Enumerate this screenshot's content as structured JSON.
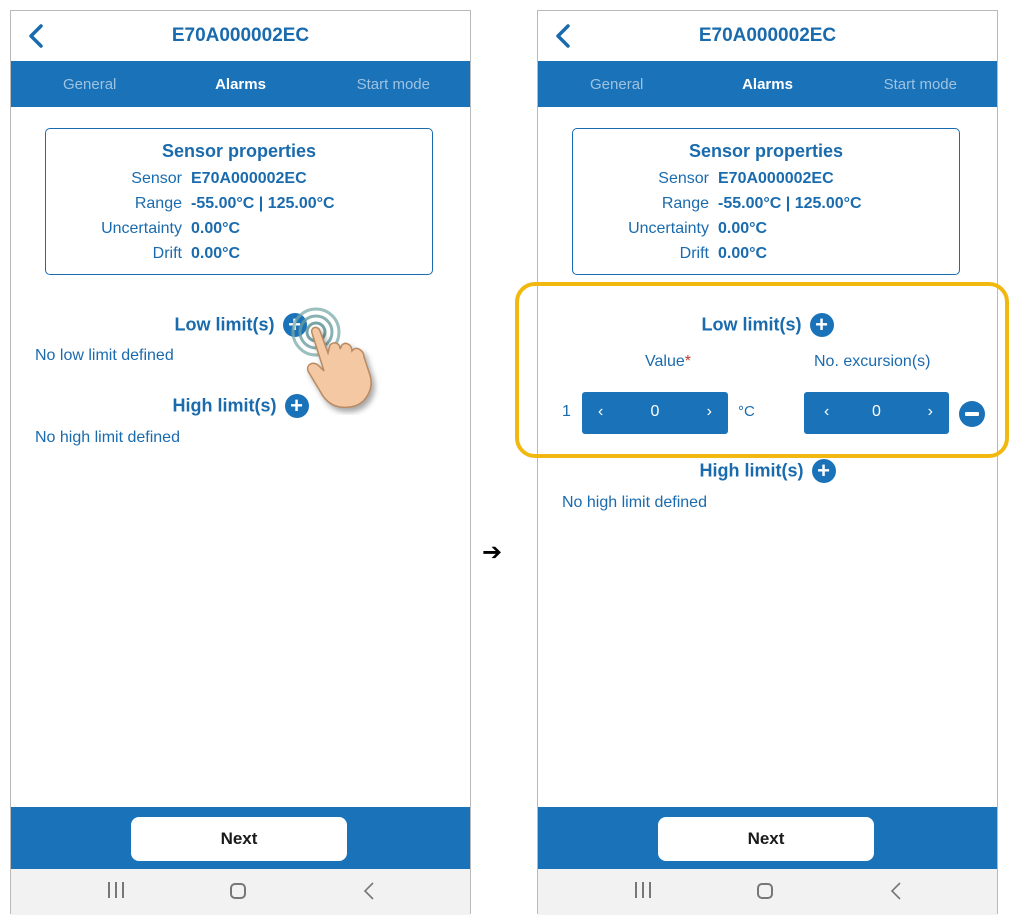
{
  "screens": [
    {
      "title": "E70A000002EC",
      "tabs": [
        "General",
        "Alarms",
        "Start mode"
      ],
      "sensor_properties": {
        "heading": "Sensor properties",
        "rows": [
          {
            "label": "Sensor",
            "value": "E70A000002EC"
          },
          {
            "label": "Range",
            "value": "-55.00°C | 125.00°C"
          },
          {
            "label": "Uncertainty",
            "value": "0.00°C"
          },
          {
            "label": "Drift",
            "value": "0.00°C"
          }
        ]
      },
      "low_limits": {
        "label": "Low limit(s)",
        "empty_text": "No low limit defined"
      },
      "high_limits": {
        "label": "High limit(s)",
        "empty_text": "No high limit defined"
      },
      "next_label": "Next"
    },
    {
      "title": "E70A000002EC",
      "tabs": [
        "General",
        "Alarms",
        "Start mode"
      ],
      "sensor_properties": {
        "heading": "Sensor properties",
        "rows": [
          {
            "label": "Sensor",
            "value": "E70A000002EC"
          },
          {
            "label": "Range",
            "value": "-55.00°C | 125.00°C"
          },
          {
            "label": "Uncertainty",
            "value": "0.00°C"
          },
          {
            "label": "Drift",
            "value": "0.00°C"
          }
        ]
      },
      "low_limits": {
        "label": "Low limit(s)",
        "value_header": "Value",
        "required_mark": "*",
        "excursion_header": "No. excursion(s)",
        "rows": [
          {
            "index": "1",
            "value": "0",
            "unit": "°C",
            "excursions": "0"
          }
        ]
      },
      "high_limits": {
        "label": "High limit(s)",
        "empty_text": "No high limit defined"
      },
      "next_label": "Next"
    }
  ],
  "annotations": {
    "transition_arrow": "➔",
    "highlight_color": "#f1b90f"
  },
  "colors": {
    "brand_blue": "#1a72b9",
    "text_blue": "#1a6bae",
    "required_red": "#c0392b"
  }
}
